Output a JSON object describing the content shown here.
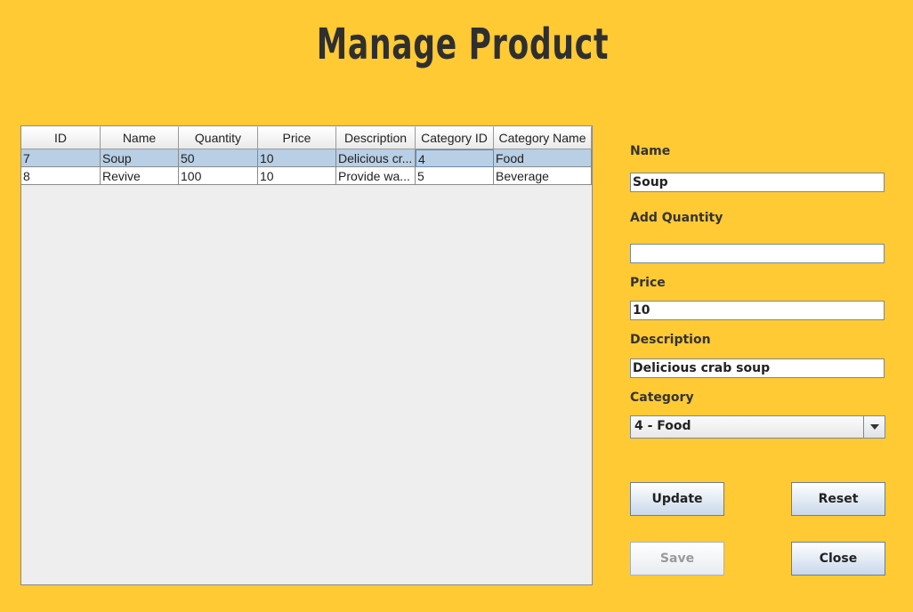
{
  "title": "Manage Product",
  "table": {
    "columns": [
      "ID",
      "Name",
      "Quantity",
      "Price",
      "Description",
      "Category ID",
      "Category Name"
    ],
    "rows": [
      [
        "7",
        "Soup",
        "50",
        "10",
        "Delicious cr...",
        "4",
        "Food"
      ],
      [
        "8",
        "Revive",
        "100",
        "10",
        "Provide wa...",
        "5",
        "Beverage"
      ]
    ],
    "selected_row": 0
  },
  "form": {
    "name_label": "Name",
    "name_value": "Soup",
    "add_quantity_label": "Add Quantity",
    "add_quantity_value": "",
    "price_label": "Price",
    "price_value": "10",
    "description_label": "Description",
    "description_value": "Delicious crab soup",
    "category_label": "Category",
    "category_value": "4 - Food"
  },
  "buttons": {
    "update": "Update",
    "reset": "Reset",
    "save": "Save",
    "close": "Close"
  },
  "colors": {
    "background": "#FFCA33",
    "selection": "#B8CFE5"
  }
}
